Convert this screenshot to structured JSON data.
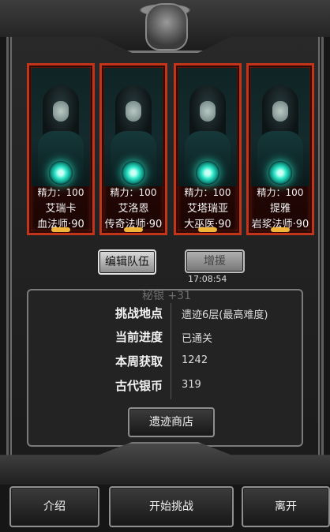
{
  "cards": [
    {
      "energy": "精力：100",
      "name": "艾瑞卡",
      "class": "血法师·90"
    },
    {
      "energy": "精力：100",
      "name": "艾洛恩",
      "class": "传奇法师·90"
    },
    {
      "energy": "精力：100",
      "name": "艾塔瑞亚",
      "class": "大巫医·90"
    },
    {
      "energy": "精力：100",
      "name": "提雅",
      "class": "岩浆法师·90"
    }
  ],
  "buttons": {
    "edit_team": "编辑队伍",
    "reinforce": "增援",
    "shop": "遗迹商店",
    "intro": "介绍",
    "start": "开始挑战",
    "leave": "离开"
  },
  "timer": "17:08:54",
  "faded_text": "秘银 +31",
  "info": {
    "location_label": "挑战地点",
    "location_value": "遗迹6层(最高难度)",
    "progress_label": "当前进度",
    "progress_value": "已通关",
    "weekly_label": "本周获取",
    "weekly_value": "1242",
    "silver_label": "古代银币",
    "silver_value": "319"
  },
  "colors": {
    "card_border": "#c2351a",
    "orb": "#2fe7c9",
    "frame": "#6b6b6b"
  }
}
